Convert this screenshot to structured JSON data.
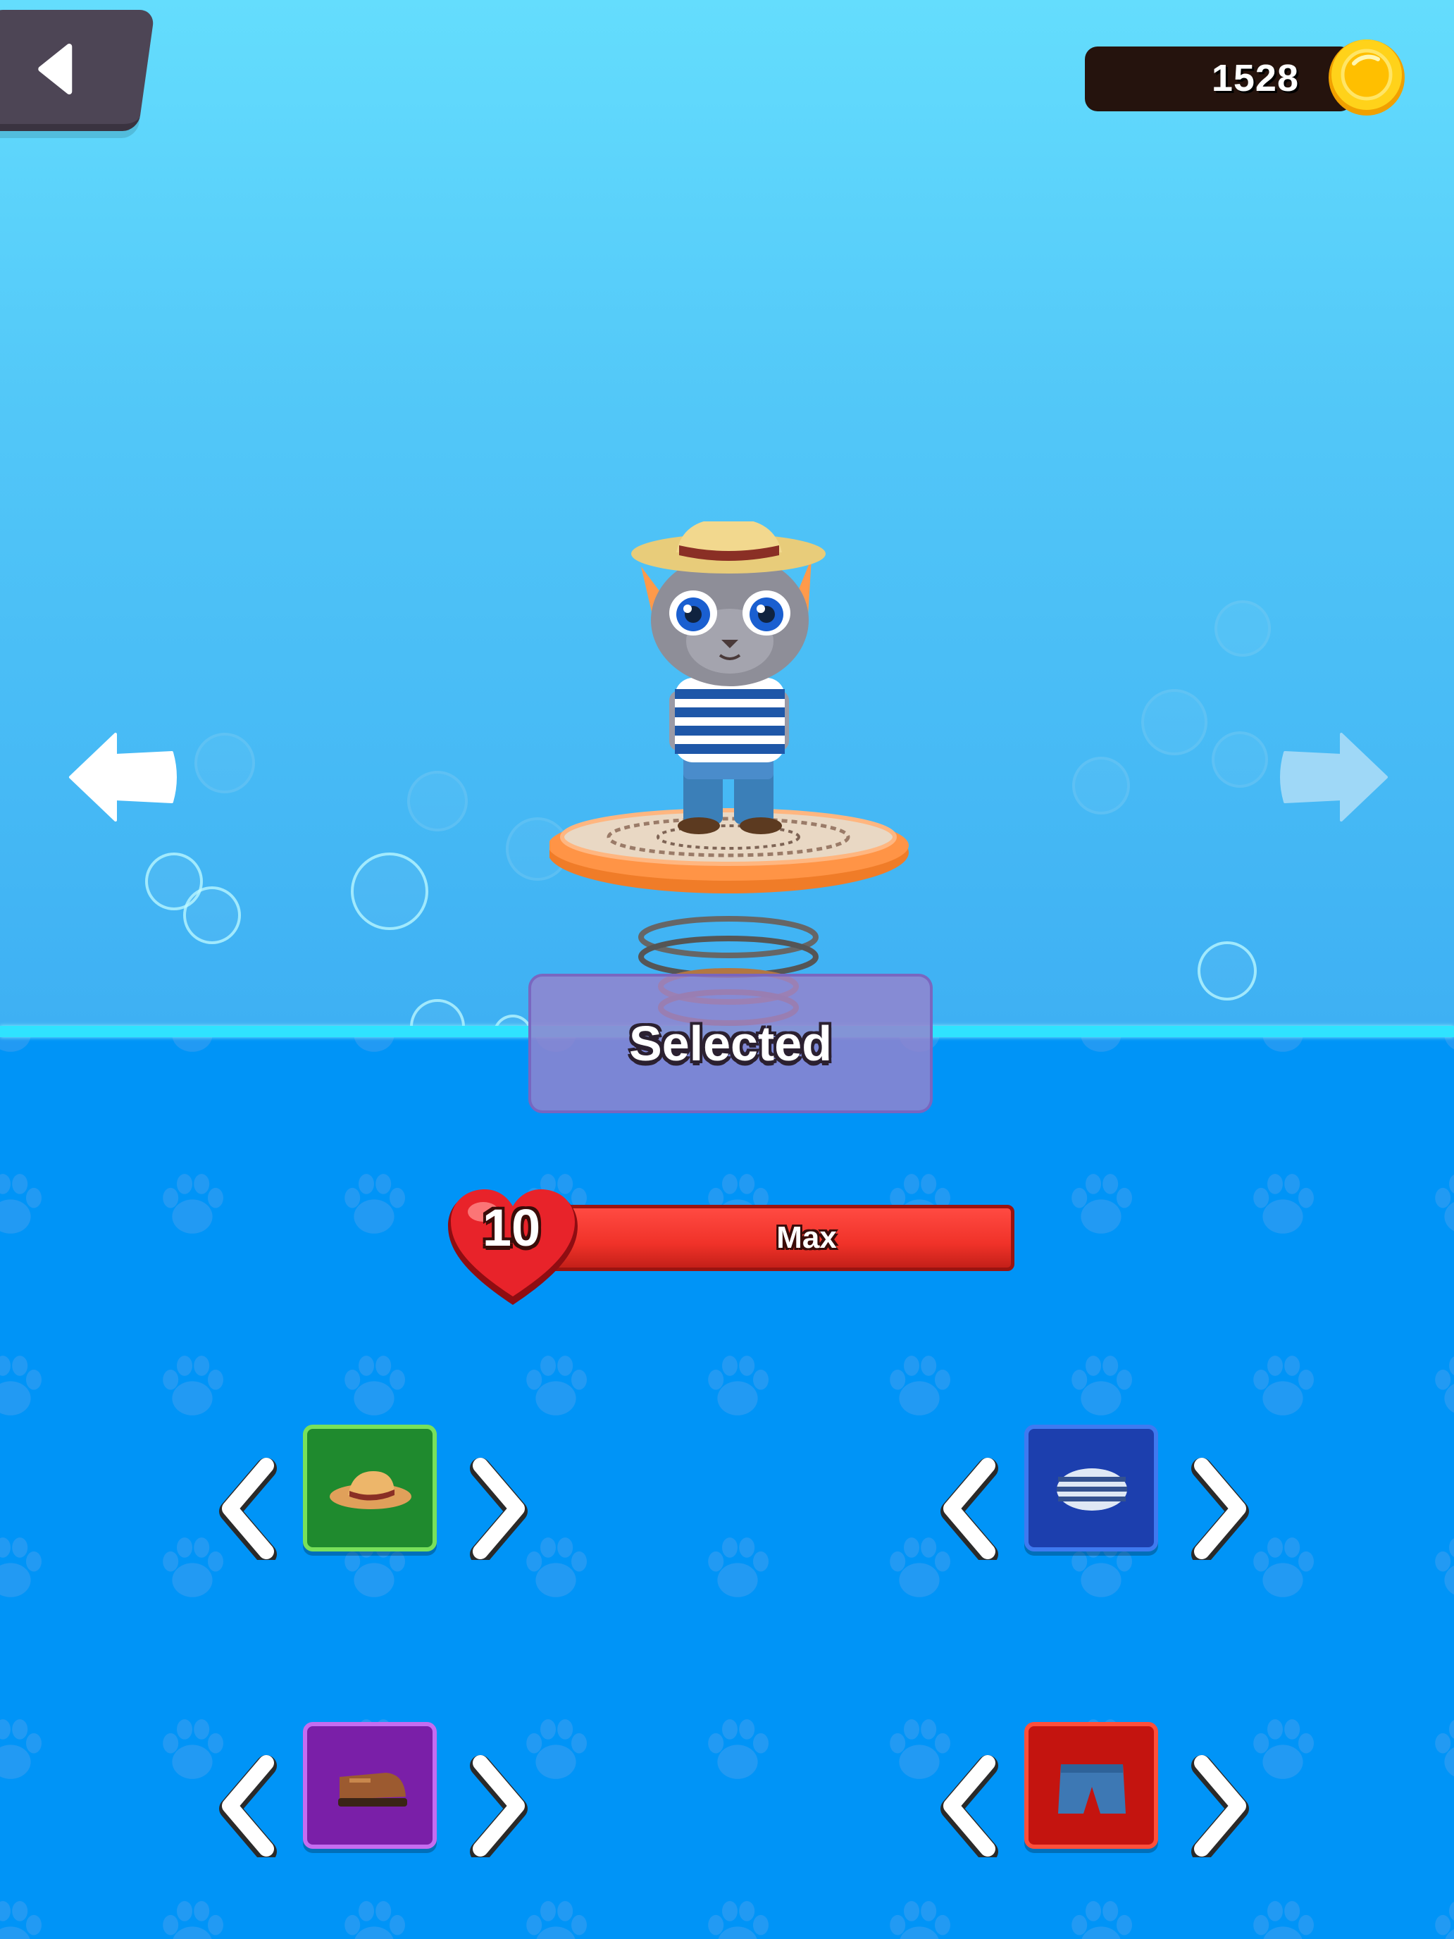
{
  "hud": {
    "back_icon": "back-triangle-icon",
    "coins": "1528",
    "coin_icon": "gold-coin-icon"
  },
  "character": {
    "name_icon": "cat-character",
    "outfit": [
      "straw-hat",
      "striped-shirt",
      "blue-jeans",
      "brown-shoes"
    ],
    "nav_prev_icon": "arrow-left-icon",
    "nav_next_icon": "arrow-right-icon"
  },
  "select_button": {
    "label": "Selected"
  },
  "level": {
    "number": "10",
    "bar_text": "Max",
    "heart_icon": "heart-icon",
    "colors": {
      "bar": "#f03229",
      "heart": "#e8232a"
    }
  },
  "equipment": {
    "slots": [
      {
        "slot": "hat",
        "icon": "straw-hat-icon",
        "color": "#1f8a2e"
      },
      {
        "slot": "shirt",
        "icon": "striped-shirt-icon",
        "color": "#1c3fae"
      },
      {
        "slot": "shoes",
        "icon": "boot-icon",
        "color": "#7a1fa8"
      },
      {
        "slot": "pants",
        "icon": "jeans-icon",
        "color": "#c4140f"
      }
    ]
  },
  "theme": {
    "sky_top": "#64ddfd",
    "floor": "#0094f7",
    "horizon": "#2fe3ff",
    "paw_print": "#3f9ff0"
  }
}
